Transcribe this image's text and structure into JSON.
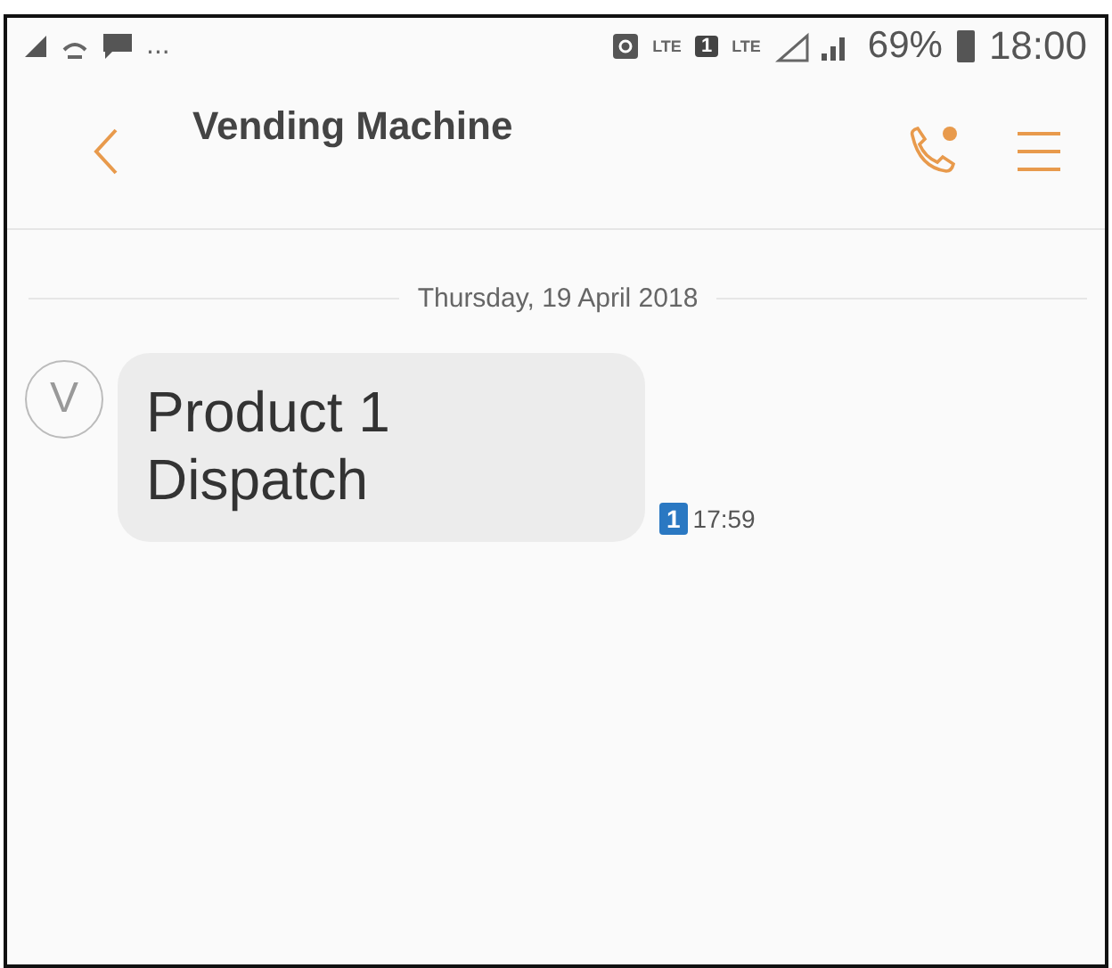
{
  "status_bar": {
    "overflow": "...",
    "volte": "LTE",
    "sim": "1",
    "network": "LTE",
    "battery": "69%",
    "time": "18:00"
  },
  "header": {
    "title": "Vending Machine"
  },
  "date_divider": "Thursday, 19 April 2018",
  "messages": [
    {
      "avatar": "V",
      "text": "Product 1 Dispatch",
      "sim": "1",
      "time": "17:59"
    }
  ]
}
